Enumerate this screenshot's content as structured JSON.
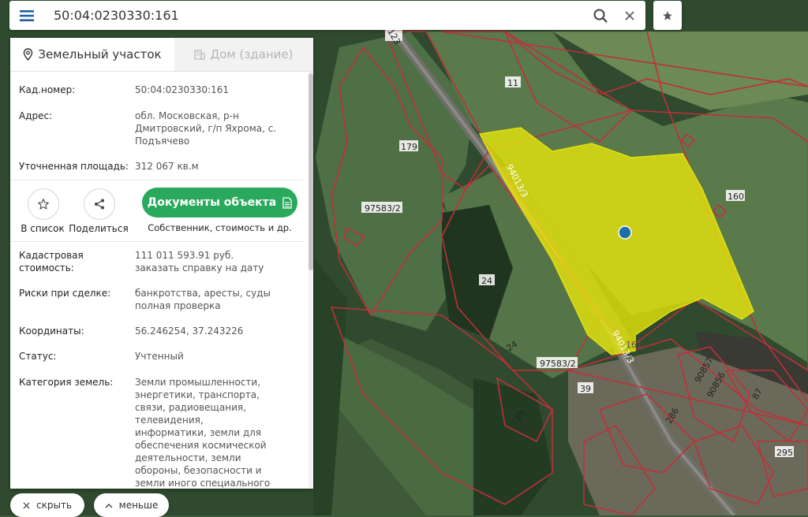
{
  "search": {
    "value": "50:04:0230330:161",
    "menu_icon": "hamburger-icon",
    "search_icon": "magnifier-icon",
    "clear_icon": "close-icon",
    "favorite_icon": "star-icon"
  },
  "tabs": [
    {
      "label": "Земельный участок",
      "icon": "map-pin-icon",
      "active": true
    },
    {
      "label": "Дом (здание)",
      "icon": "building-icon",
      "active": false
    }
  ],
  "info": {
    "cad_number_label": "Кад.номер:",
    "cad_number_value": "50:04:0230330:161",
    "address_label": "Адрес:",
    "address_value": "обл. Московская, р-н Дмитровский, г/п Яхрома, с. Подъячево",
    "area_label": "Уточненная площадь:",
    "area_value": "312 067 кв.м",
    "cost_label": "Кадастровая стоимость:",
    "cost_value": "111 011 593.91 руб.",
    "cost_link": "заказать справку на дату",
    "risks_label": "Риски при сделке:",
    "risks_value": "банкротства, аресты, суды",
    "risks_link": "полная проверка",
    "coords_label": "Координаты:",
    "coords_value": "56.246254, 37.243226",
    "status_label": "Статус:",
    "status_value": "Учтенный",
    "category_label": "Категория земель:",
    "category_value": "Земли промышленности, энергетики, транспорта, связи, радиовещания, телевидения, информатики, земли для обеспечения космической деятельности, земли обороны, безопасности и земли иного специального назначения"
  },
  "actions": {
    "list_label": "В список",
    "share_label": "Поделиться",
    "docs_label": "Документы объекта",
    "docs_sub": "Собственник, стоимость и др."
  },
  "bottom": {
    "hide_label": "скрыть",
    "less_label": "меньше"
  },
  "map_labels": {
    "road_top": "123",
    "road_mid": "94013/3",
    "road_low": "94013/3",
    "p11": "11",
    "p179": "179",
    "p160": "160",
    "p97583a": "97583/2",
    "p97583b": "97583/2",
    "p24a": "24",
    "p24b": "24",
    "p25": "25",
    "p39": "39",
    "p286": "286",
    "p90857": "90857",
    "p90856": "90856",
    "p87": "87",
    "p295": "295",
    "p161": "161"
  },
  "colors": {
    "accent_green": "#2aa95c",
    "link_blue": "#1f7fa6",
    "parcel_border": "#c0303a",
    "selected_fill": "#e6e60a",
    "marker": "#1e6fa8"
  }
}
